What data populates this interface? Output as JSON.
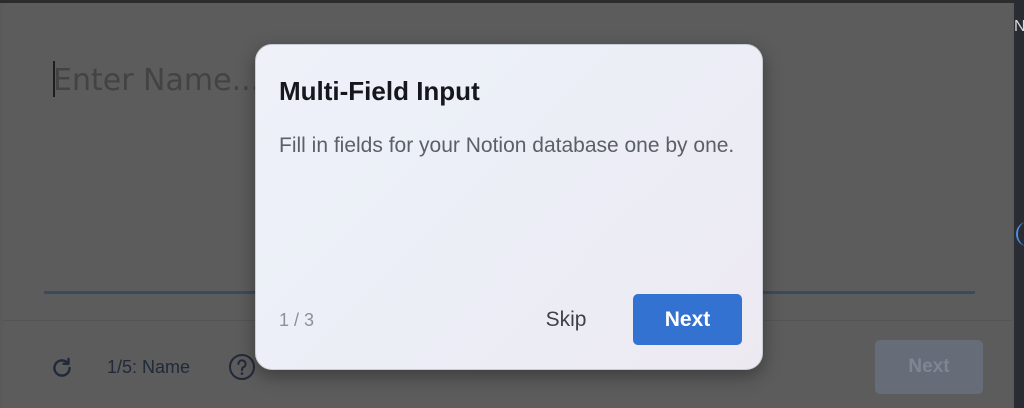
{
  "app": {
    "name_input": {
      "placeholder": "Enter Name..."
    },
    "footer": {
      "refresh_icon": "refresh-icon",
      "step_label": "1/5: Name",
      "help_icon": "help-icon",
      "next_label": "Next"
    }
  },
  "tour": {
    "title": "Multi-Field Input",
    "body": "Fill in fields for your Notion database one by one.",
    "progress": "1 / 3",
    "skip_label": "Skip",
    "next_label": "Next"
  },
  "colors": {
    "primary": "#3472d1",
    "overlay": "#5a5a5a"
  }
}
